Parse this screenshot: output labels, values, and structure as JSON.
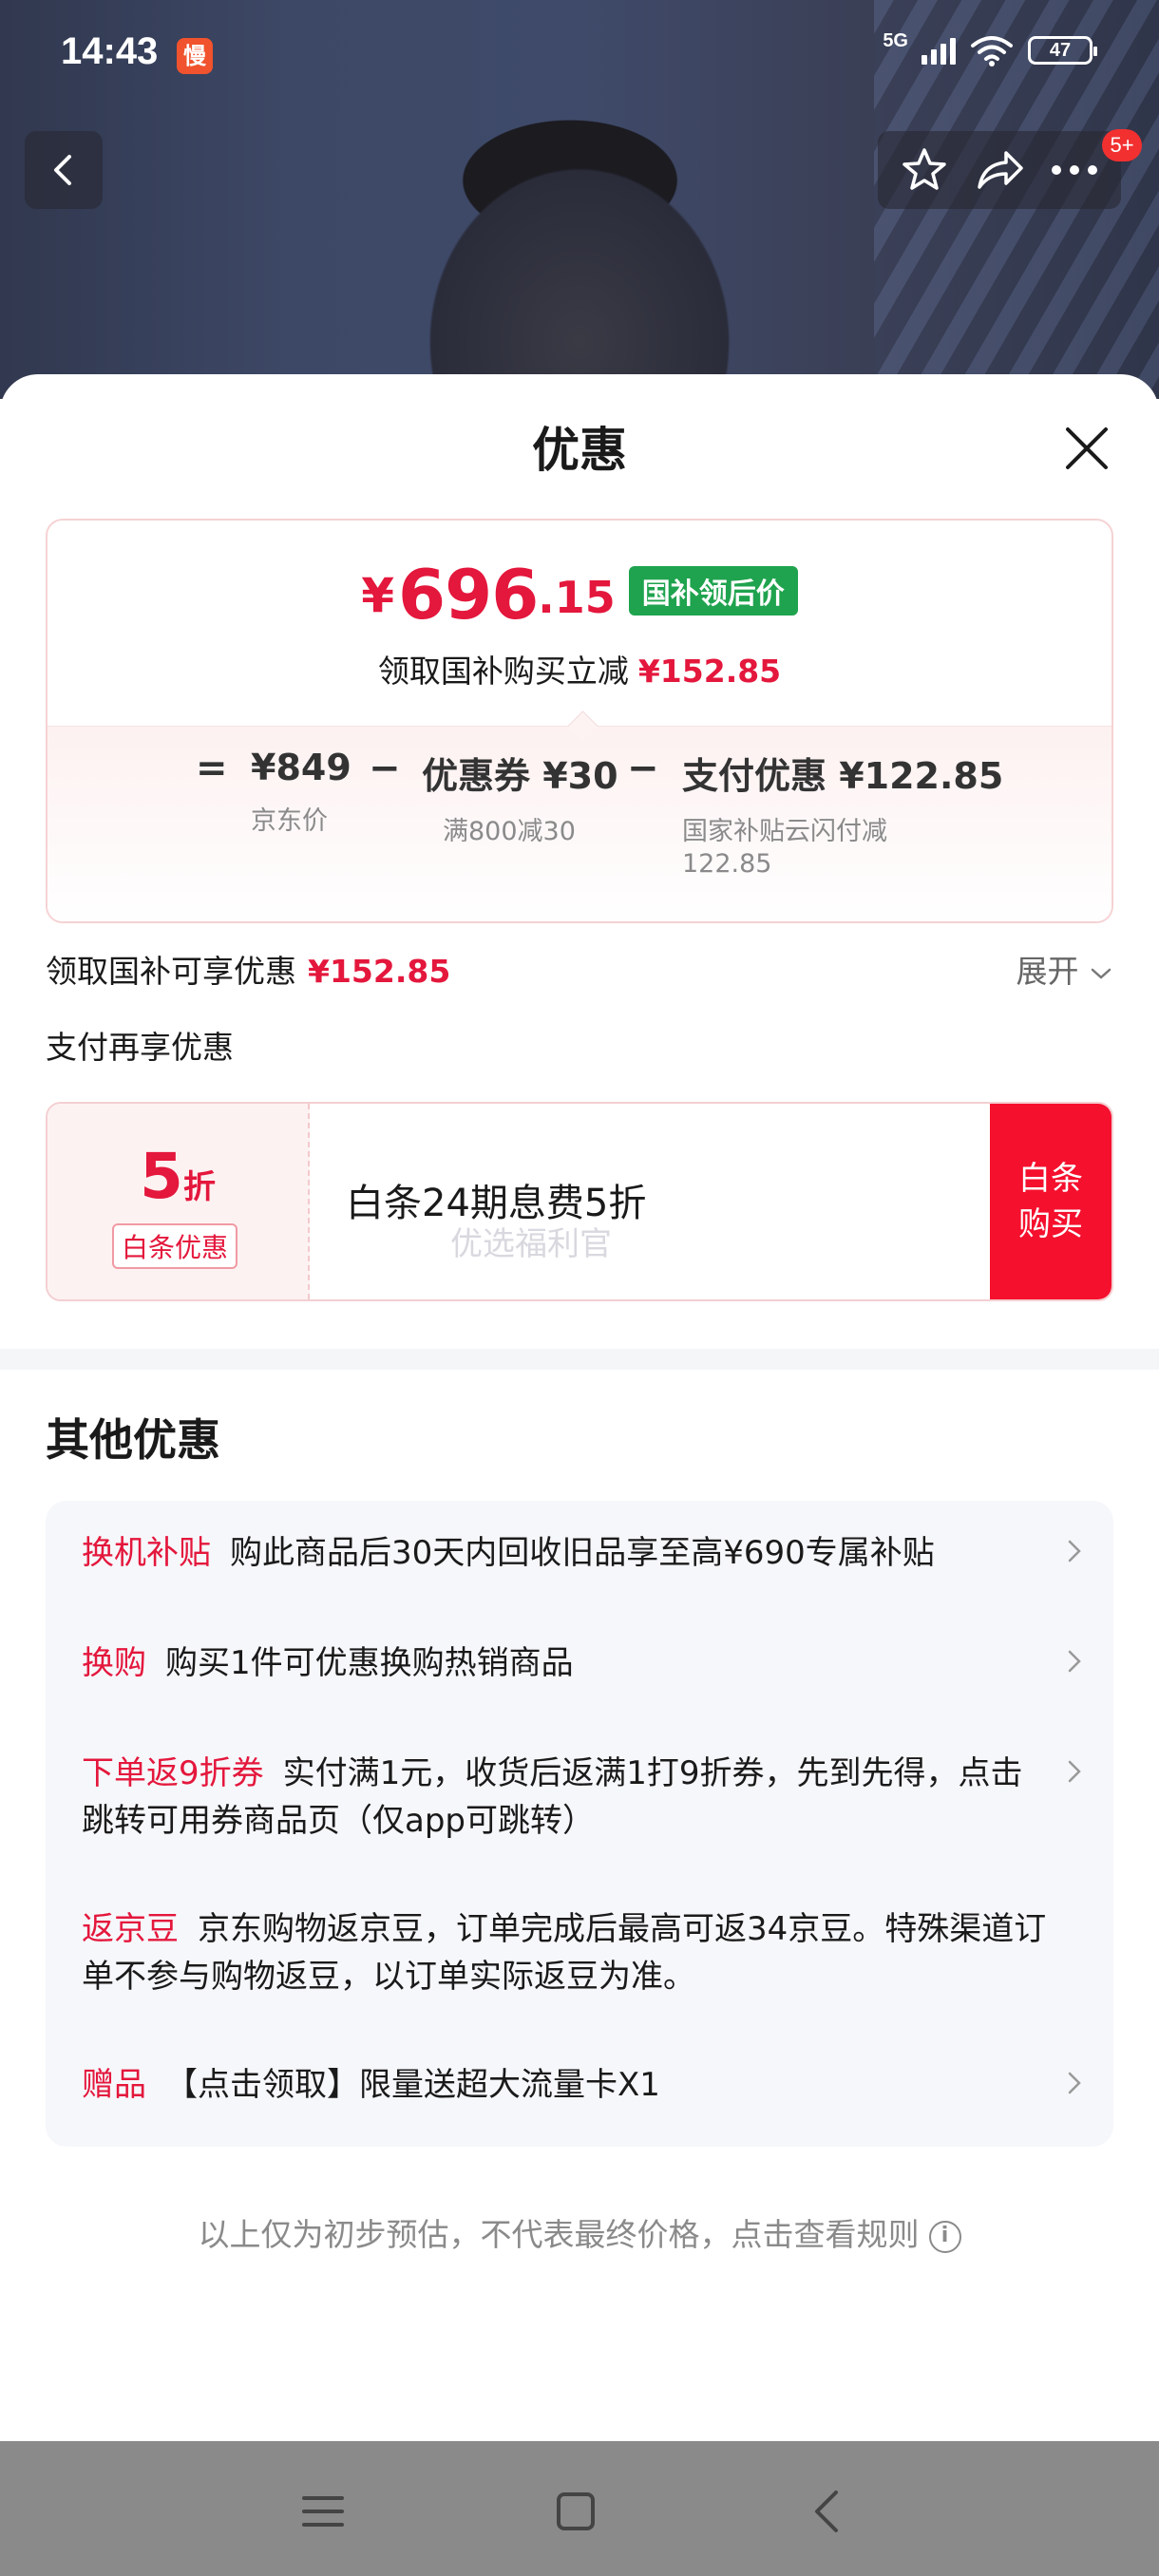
{
  "status_bar": {
    "time": "14:43",
    "app_badge": "慢",
    "network": "5G",
    "battery": "47"
  },
  "top_nav": {
    "cart_badge": "5+"
  },
  "sheet": {
    "title": "优惠",
    "summary": {
      "currency": "¥",
      "price_int": "696",
      "price_dec": ".15",
      "price_tag": "国补领后价",
      "subsidy_text": "领取国补购买立减",
      "subsidy_amount": "¥152.85",
      "formula": [
        {
          "op": "=",
          "value": "¥849",
          "desc": "京东价"
        },
        {
          "op": "−",
          "value": "优惠券 ¥30",
          "desc": "满800减30"
        },
        {
          "op": "−",
          "value": "支付优惠 ¥122.85",
          "desc_line1": "国家补贴云闪付减",
          "desc_line2": "122.85"
        }
      ]
    },
    "total_row": {
      "label": "领取国补可享优惠",
      "amount": "¥152.85",
      "expand": "展开"
    },
    "pay_section_title": "支付再享优惠",
    "baitiao": {
      "discount_num": "5",
      "discount_unit": "折",
      "tag": "白条优惠",
      "desc": "白条24期息费5折",
      "watermark": "优选福利官",
      "button_line1": "白条",
      "button_line2": "购买"
    },
    "other_title": "其他优惠",
    "other_items": [
      {
        "key": "换机补贴",
        "text": "购此商品后30天内回收旧品享至高¥690专属补贴"
      },
      {
        "key": "换购",
        "text": "购买1件可优惠换购热销商品"
      },
      {
        "key": "下单返9折券",
        "text": "实付满1元，收货后返满1打9折券，先到先得，点击跳转可用券商品页（仅app可跳转）"
      },
      {
        "key": "返京豆",
        "text": "京东购物返京豆，订单完成后最高可返34京豆。特殊渠道订单不参与购物返豆，以订单实际返豆为准。"
      },
      {
        "key": "赠品",
        "text": "【点击领取】限量送超大流量卡X1"
      }
    ],
    "footer_note": "以上仅为初步预估，不代表最终价格，点击查看规则",
    "footer_info_glyph": "i"
  },
  "colors": {
    "accent_red": "#e4173c",
    "green_tag": "#1fa34e",
    "button_red": "#f5102e"
  }
}
